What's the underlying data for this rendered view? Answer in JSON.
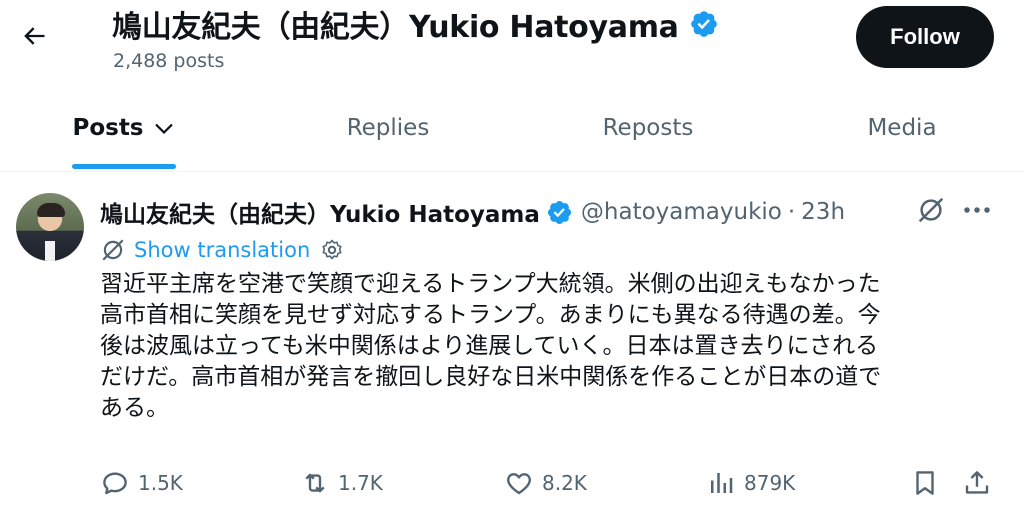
{
  "header": {
    "title": "鳩山友紀夫（由紀夫）Yukio Hatoyama",
    "post_count": "2,488 posts",
    "follow_label": "Follow"
  },
  "tabs": [
    {
      "label": "Posts"
    },
    {
      "label": "Replies"
    },
    {
      "label": "Reposts"
    },
    {
      "label": "Media"
    }
  ],
  "tweet": {
    "author_name": "鳩山友紀夫（由紀夫）Yukio Hatoyama",
    "handle": "@hatoyamayukio",
    "separator": "·",
    "time": "23h",
    "translate_label": "Show translation",
    "text_lines": [
      "習近平主席を空港で笑顔で迎えるトランプ大統領。米側の出迎えもなかった",
      "高市首相に笑顔を見せず対応するトランプ。あまりにも異なる待遇の差。今",
      "後は波風は立っても米中関係はより進展していく。日本は置き去りにされる",
      "だけだ。高市首相が発言を撤回し良好な日米中関係を作ることが日本の道で",
      "ある。"
    ],
    "actions": {
      "replies": "1.5K",
      "reposts": "1.7K",
      "likes": "8.2K",
      "views": "879K"
    }
  },
  "colors": {
    "accent": "#1d9bf0",
    "text": "#0f1419",
    "secondary": "#536471",
    "follow_bg": "#0f1419"
  },
  "icons": [
    "back-arrow-icon",
    "verified-badge-icon",
    "chevron-down-icon",
    "grok-icon",
    "more-icon",
    "translate-icon",
    "gear-icon",
    "reply-icon",
    "repost-icon",
    "like-icon",
    "views-icon",
    "bookmark-icon",
    "share-icon"
  ]
}
